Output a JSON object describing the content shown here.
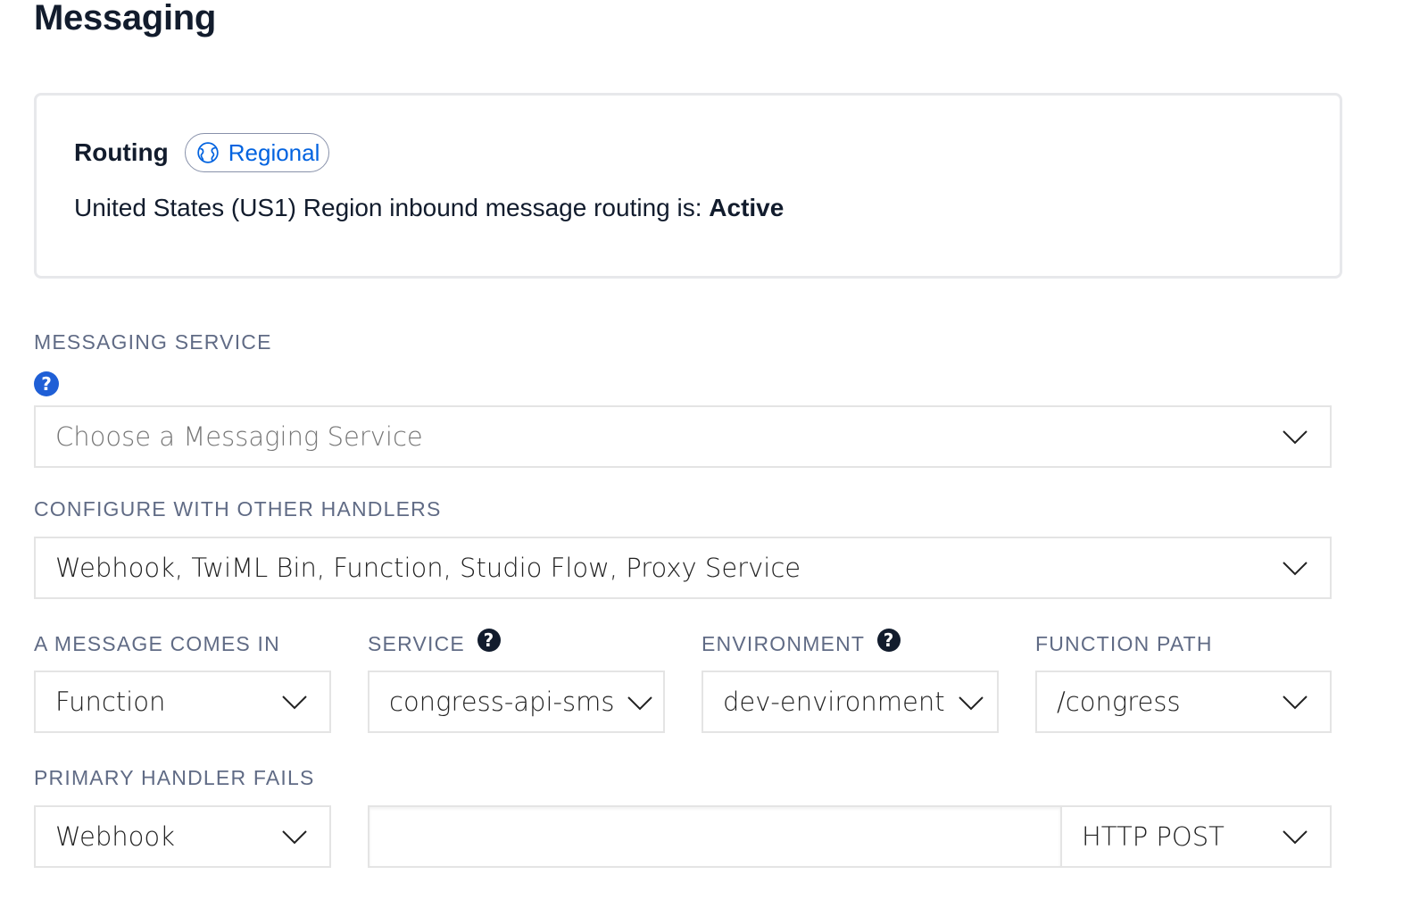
{
  "page": {
    "title": "Messaging"
  },
  "routing": {
    "label": "Routing",
    "badge": {
      "icon": "globe-icon",
      "label": "Regional",
      "color": "#0263e0"
    },
    "status_prefix": "United States (US1) Region inbound message routing is: ",
    "status_value": "Active"
  },
  "messaging_service": {
    "label": "MESSAGING SERVICE",
    "help_icon": "question-circle-icon",
    "select": {
      "value": "",
      "placeholder": "Choose a Messaging Service"
    }
  },
  "other_handlers": {
    "label": "CONFIGURE WITH OTHER HANDLERS",
    "select": {
      "value": "Webhook, TwiML Bin, Function, Studio Flow, Proxy Service"
    }
  },
  "message_comes_in": {
    "label": "A MESSAGE COMES IN",
    "select": {
      "value": "Function"
    }
  },
  "service": {
    "label": "SERVICE",
    "help_icon": "question-circle-icon",
    "select": {
      "value": "congress-api-sms"
    }
  },
  "environment": {
    "label": "ENVIRONMENT",
    "help_icon": "question-circle-icon",
    "select": {
      "value": "dev-environment"
    }
  },
  "function_path": {
    "label": "FUNCTION PATH",
    "select": {
      "value": "/congress"
    }
  },
  "primary_handler_fails": {
    "label": "PRIMARY HANDLER FAILS",
    "select": {
      "value": "Webhook"
    },
    "url_input": {
      "value": "",
      "placeholder": ""
    },
    "method_select": {
      "value": "HTTP POST"
    }
  },
  "icons": {
    "help": "?",
    "chevron": "chevron-down-icon"
  },
  "colors": {
    "accent": "#0263e0",
    "help_blue": "#1f5fd6",
    "text_dark": "#121c2d",
    "label_gray": "#606b85",
    "border": "#e4e4e4"
  }
}
